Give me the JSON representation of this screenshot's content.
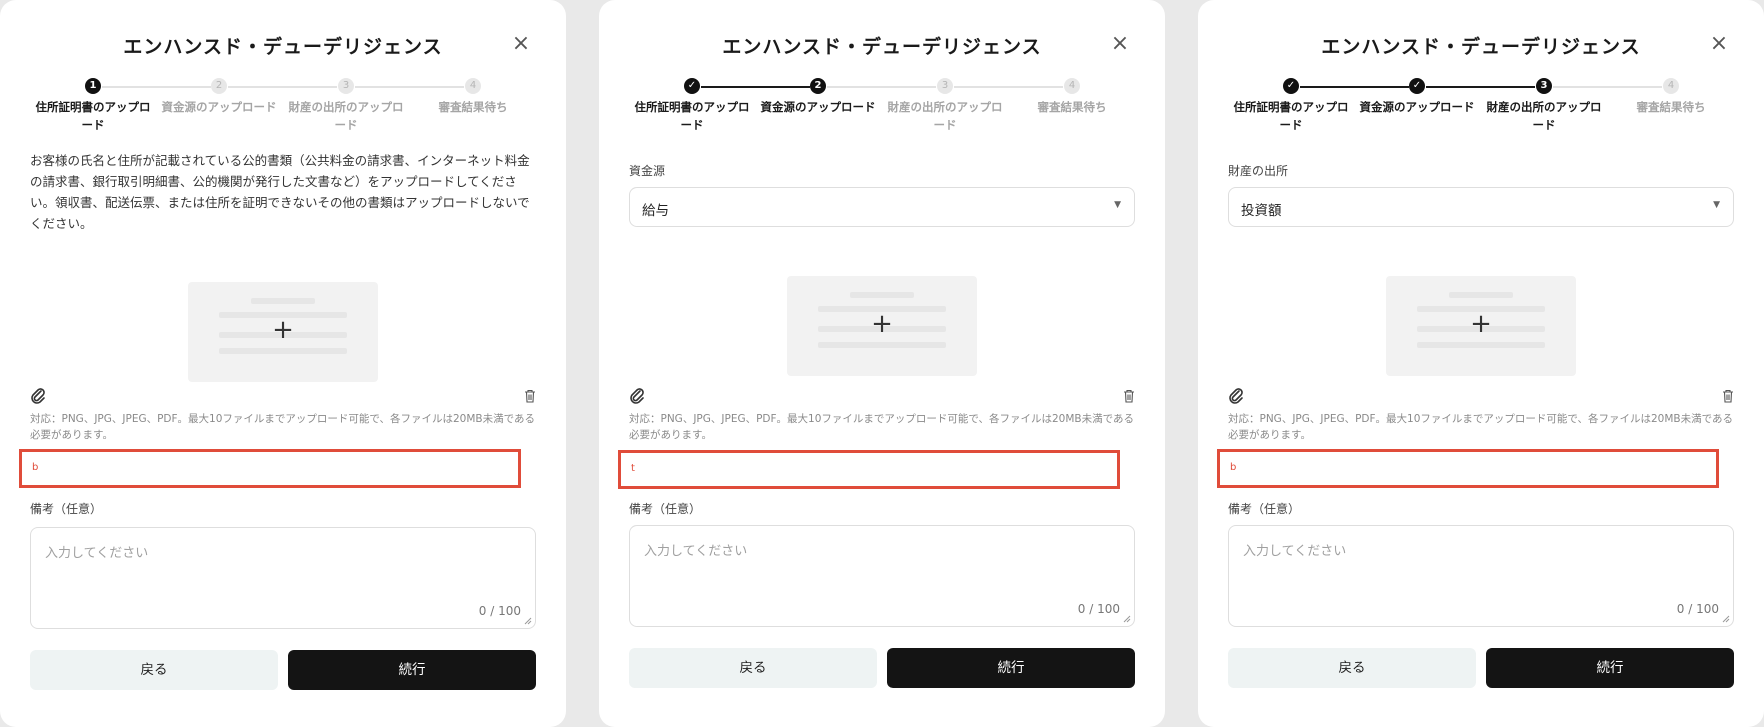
{
  "modal": {
    "title": "エンハンスド・デューデリジェンス",
    "close_glyph": "×"
  },
  "steps": [
    {
      "label": "住所証明書のアップロード",
      "number": "1"
    },
    {
      "label": "資金源のアップロード",
      "number": "2"
    },
    {
      "label": "財産の出所のアップロード",
      "number": "3"
    },
    {
      "label": "審査結果待ち",
      "number": "4"
    }
  ],
  "check_glyph": "✓",
  "panels": [
    {
      "active_step": 0,
      "description": "お客様の氏名と住所が記載されている公的書類（公共料金の請求書、インターネット料金の請求書、銀行取引明細書、公的機関が発行した文書など）をアップロードしてください。領収書、配送伝票、または住所を証明できないその他の書類はアップロードしないでください。",
      "field_label": "",
      "select_value": "",
      "error_text": "b"
    },
    {
      "active_step": 1,
      "description": "",
      "field_label": "資金源",
      "select_value": "給与",
      "error_text": "t"
    },
    {
      "active_step": 2,
      "description": "",
      "field_label": "財産の出所",
      "select_value": "投資額",
      "error_text": "b"
    }
  ],
  "upload": {
    "plus_glyph": "+",
    "support_text": "対応：PNG、JPG、JPEG、PDF。最大10ファイルまでアップロード可能で、各ファイルは20MB未満である必要があります。"
  },
  "notes": {
    "label": "備考（任意）",
    "placeholder": "入力してください",
    "counter": "0 / 100"
  },
  "buttons": {
    "back": "戻る",
    "next": "続行"
  },
  "colors": {
    "primary": "#141414",
    "error": "#e04c3a",
    "back_button": "#eef3f3",
    "upload_tile": "#f2f2f2"
  }
}
